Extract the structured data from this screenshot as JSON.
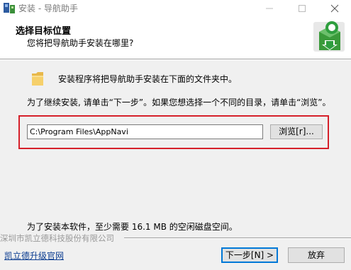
{
  "window": {
    "title": "安装 - 导航助手"
  },
  "header": {
    "title": "选择目标位置",
    "subtitle": "您将把导航助手安装在哪里?"
  },
  "body": {
    "folder_message": "安装程序将把导航助手安装在下面的文件夹中。",
    "instruction": "为了继续安装, 请单击“下一步”。如果您想选择一个不同的目录，请单击“浏览”。",
    "path_value": "C:\\Program Files\\AppNavi",
    "browse_label": "浏览[r]...",
    "space_requirement": "为了安装本软件，至少需要 16.1 MB 的空闲磁盘空间。"
  },
  "footer": {
    "watermark": "深圳市凯立德科技股份有限公司",
    "link": "凯立德升级官网",
    "next_label": "下一步[N] >",
    "cancel_label": "放弃"
  },
  "icons": {
    "app": "installer-icon",
    "header_logo": "install-package-icon",
    "folder": "folder-icon"
  },
  "colors": {
    "highlight_border": "#d6202a",
    "link": "#0b3d91",
    "logo_green": "#2e9e3e"
  }
}
